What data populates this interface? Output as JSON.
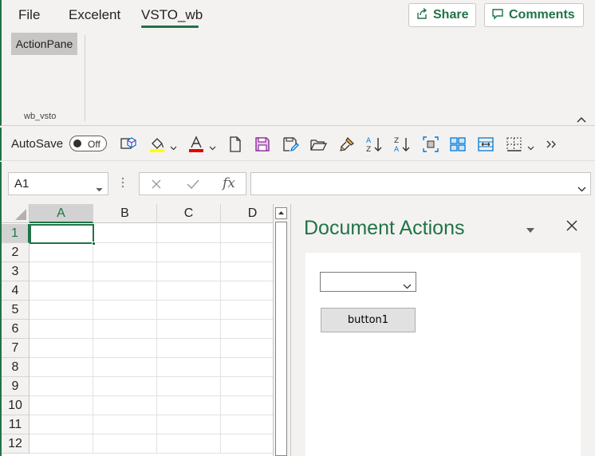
{
  "tabs": [
    {
      "label": "File"
    },
    {
      "label": "Excelent"
    },
    {
      "label": "VSTO_wb",
      "active": true
    }
  ],
  "share_label": "Share",
  "comments_label": "Comments",
  "ribbon": {
    "actionpane_label": "ActionPane",
    "group_label": "wb_vsto"
  },
  "qat": {
    "autosave_label": "AutoSave",
    "autosave_state": "Off",
    "icons": [
      "3d-model-icon",
      "fill-color-icon",
      "font-color-icon",
      "new-document-icon",
      "save-icon",
      "save-as-icon",
      "open-folder-icon",
      "format-painter-icon",
      "sort-ascending-icon",
      "sort-descending-icon",
      "select-all-icon",
      "grid-layout-icon",
      "merge-cells-icon",
      "borders-icon",
      "more-commands-icon"
    ]
  },
  "formula_bar": {
    "name_box": "A1",
    "fx_label": "fx",
    "formula_value": ""
  },
  "grid": {
    "columns": [
      "A",
      "B",
      "C",
      "D"
    ],
    "rows": [
      "1",
      "2",
      "3",
      "4",
      "5",
      "6",
      "7",
      "8",
      "9",
      "10",
      "11",
      "12"
    ],
    "active_cell": "A1"
  },
  "pane": {
    "title": "Document Actions",
    "combo_value": "",
    "button_label": "button1"
  },
  "colors": {
    "accent": "#217346",
    "ribbon_bg": "#f3f2f1"
  }
}
